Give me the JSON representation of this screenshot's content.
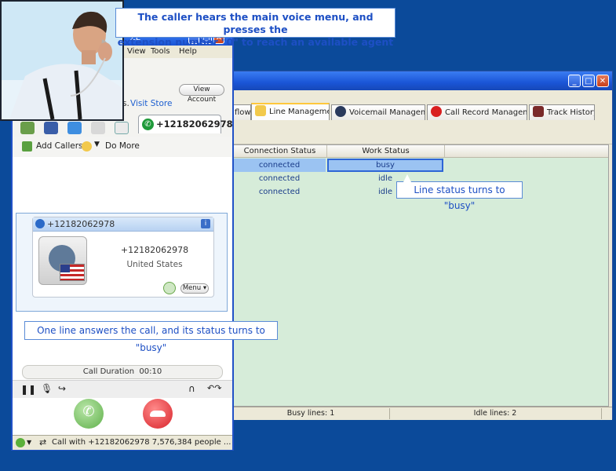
{
  "callouts": {
    "top_line1": "The caller hears the main voice menu, and presses the",
    "top_line2": "extension number \"0\" to reach an available agent",
    "line_status": "Line status turns to \"busy\"",
    "one_line": "One line answers the call, and its status turns to \"busy\""
  },
  "call_window": {
    "title_partial": "ZE",
    "menu": [
      "View",
      "Tools",
      "Help"
    ],
    "view_account_label": "View Account",
    "visit_store_prefix": "s.",
    "visit_store_label": "Visit Store",
    "active_tab_number": "+12182062978",
    "add_callers_label": "Add Callers",
    "do_more_label": "Do More",
    "card_header_number": "+12182062978",
    "card_number": "+12182062978",
    "card_country": "United States",
    "card_menu_label": "Menu",
    "duration_label": "Call Duration",
    "duration_value": "00:10",
    "status_text": "Call with +12182062978 7,576,384 people ..."
  },
  "manager_window": {
    "tabs": [
      {
        "label": "flow"
      },
      {
        "label": "Line Management"
      },
      {
        "label": "Voicemail Management"
      },
      {
        "label": "Call Record Management"
      },
      {
        "label": "Track History"
      }
    ],
    "columns": [
      "Connection Status",
      "Work Status"
    ],
    "rows": [
      {
        "connection": "connected",
        "work": "busy"
      },
      {
        "connection": "connected",
        "work": "idle"
      },
      {
        "connection": "connected",
        "work": "idle"
      }
    ],
    "status_busy": "Busy lines: 1",
    "status_idle": "Idle lines: 2"
  },
  "colors": {
    "desktop": "#0b4a9a",
    "accent_blue": "#1d4fc4",
    "grid_green": "#d6ecd9",
    "answer_green": "#6cc46a",
    "hangup_red": "#e23a3a"
  }
}
